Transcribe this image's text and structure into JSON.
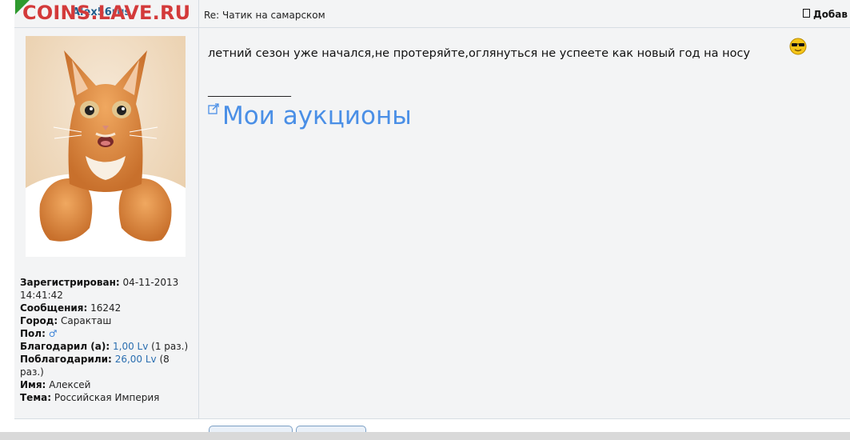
{
  "watermark": "COINS.LAVE.RU",
  "post": {
    "author": "Alex56rus",
    "subject": "Re: Чатик на самарском",
    "add_label": "Добав",
    "message": "летний сезон уже начался,не протеряйте,оглянуться не успеете как новый год на носу",
    "signature_line": "________________",
    "auction_link": "Мои аукционы"
  },
  "profile": {
    "registered_label": "Зарегистрирован:",
    "registered_value": "04-11-2013 14:41:42",
    "messages_label": "Сообщения:",
    "messages_value": "16242",
    "city_label": "Город:",
    "city_value": "Саракташ",
    "gender_label": "Пол:",
    "gender_icon": "male-icon",
    "thanked_label": "Благодарил (а):",
    "thanked_amount": "1,00 Lv",
    "thanked_count": "(1 раз.)",
    "was_thanked_label": "Поблагодарили:",
    "was_thanked_amount": "26,00 Lv",
    "was_thanked_count": "(8 раз.)",
    "name_label": "Имя:",
    "name_value": "Алексей",
    "topic_label": "Тема:",
    "topic_value": "Российская Империя"
  },
  "colors": {
    "link": "#4a8fe6",
    "author": "#1f5d8c",
    "watermark": "#d33a3a",
    "panel_bg": "#f3f4f5"
  }
}
